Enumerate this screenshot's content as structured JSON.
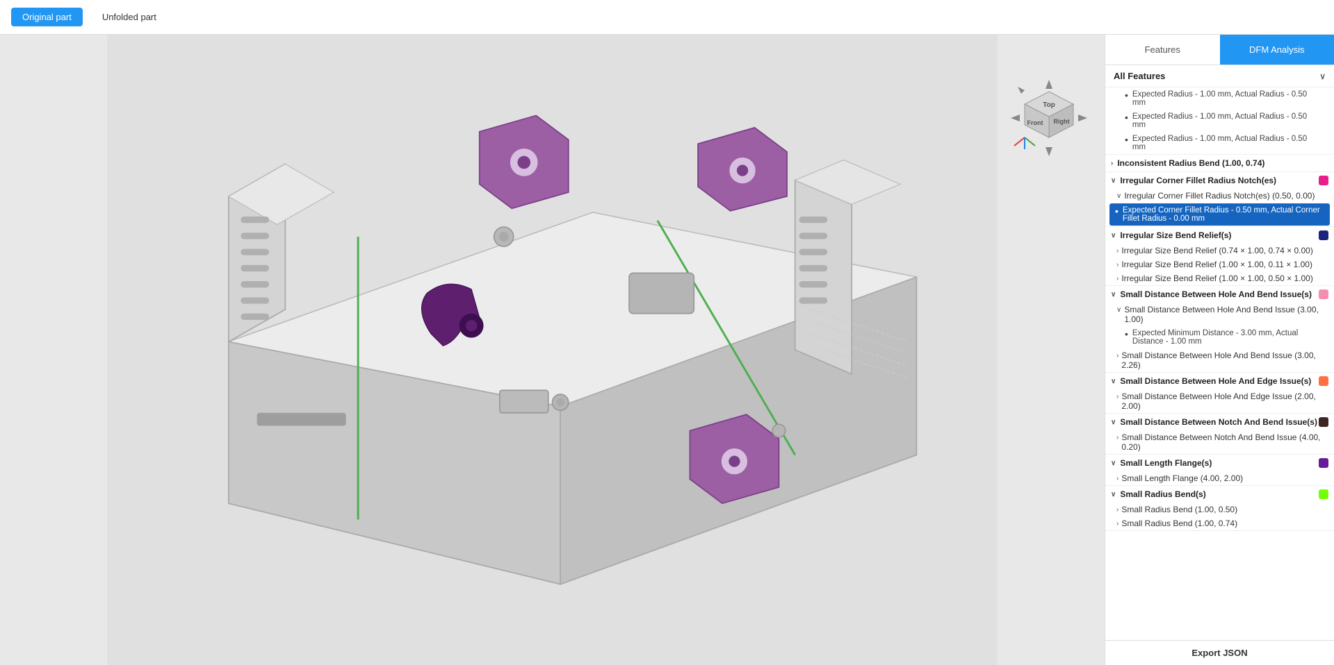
{
  "topBar": {
    "originalLabel": "Original part",
    "unfoldedLabel": "Unfolded part"
  },
  "tabs": [
    {
      "id": "features",
      "label": "Features",
      "active": false
    },
    {
      "id": "dfm",
      "label": "DFM Analysis",
      "active": true
    }
  ],
  "allFeatures": {
    "label": "All Features"
  },
  "featureGroups": [
    {
      "id": "inconsistent-radius-above",
      "items": [
        {
          "text": "Expected Radius - 1.00 mm, Actual Radius - 0.50 mm",
          "bullet": true
        },
        {
          "text": "Expected Radius - 1.00 mm, Actual Radius - 0.50 mm",
          "bullet": true
        },
        {
          "text": "Expected Radius - 1.00 mm, Actual Radius - 0.50 mm",
          "bullet": true
        }
      ],
      "collapsed": false,
      "showHeader": false
    },
    {
      "id": "inconsistent-radius-bend",
      "header": "Inconsistent Radius Bend (1.00, 0.74)",
      "chevron": "›",
      "collapsed": true,
      "showHeader": true
    },
    {
      "id": "irregular-corner-fillet",
      "header": "Irregular Corner Fillet Radius Notch(es)",
      "chevron": "∨",
      "collapsed": false,
      "showHeader": true,
      "color": "#e91e8c",
      "sub": [
        {
          "id": "irrg-corner-sub",
          "text": "Irregular Corner Fillet Radius Notch(es) (0.50, 0.00)",
          "chevron": "∨",
          "items": [
            {
              "text": "Expected Corner Fillet Radius - 0.50 mm, Actual Corner Fillet Radius - 0.00 mm",
              "bullet": true,
              "highlighted": true
            }
          ]
        }
      ]
    },
    {
      "id": "irregular-size-bend-relief",
      "header": "Irregular Size Bend Relief(s)",
      "chevron": "∨",
      "collapsed": false,
      "showHeader": true,
      "color": "#1a237e",
      "sub": [
        {
          "text": "Irregular Size Bend Relief (0.74 × 1.00, 0.74 × 0.00)",
          "chevron": "›"
        },
        {
          "text": "Irregular Size Bend Relief (1.00 × 1.00, 0.11 × 1.00)",
          "chevron": "›"
        },
        {
          "text": "Irregular Size Bend Relief (1.00 × 1.00, 0.50 × 1.00)",
          "chevron": "›"
        }
      ]
    },
    {
      "id": "small-dist-hole-bend",
      "header": "Small Distance Between Hole And Bend Issue(s)",
      "chevron": "∨",
      "collapsed": false,
      "showHeader": true,
      "color": "#f48fb1",
      "sub": [
        {
          "text": "Small Distance Between Hole And Bend Issue (3.00, 1.00)",
          "chevron": "∨",
          "items": [
            {
              "text": "Expected Minimum Distance - 3.00 mm, Actual Distance - 1.00 mm",
              "bullet": true
            }
          ]
        },
        {
          "text": "Small Distance Between Hole And Bend Issue (3.00, 2.26)",
          "chevron": "›"
        }
      ]
    },
    {
      "id": "small-dist-hole-edge",
      "header": "Small Distance Between Hole And Edge Issue(s)",
      "chevron": "∨",
      "collapsed": false,
      "showHeader": true,
      "color": "#ff7043",
      "sub": [
        {
          "text": "Small Distance Between Hole And Edge Issue (2.00, 2.00)",
          "chevron": "›"
        }
      ]
    },
    {
      "id": "small-dist-notch-bend",
      "header": "Small Distance Between Notch And Bend Issue(s)",
      "chevron": "∨",
      "collapsed": false,
      "showHeader": true,
      "color": "#3e2723",
      "sub": [
        {
          "text": "Small Distance Between Notch And Bend Issue (4.00, 0.20)",
          "chevron": "›"
        }
      ]
    },
    {
      "id": "small-length-flange",
      "header": "Small Length Flange(s)",
      "chevron": "∨",
      "collapsed": false,
      "showHeader": true,
      "color": "#6a1b9a",
      "sub": [
        {
          "text": "Small Length Flange (4.00, 2.00)",
          "chevron": "›"
        }
      ]
    },
    {
      "id": "small-radius-bend",
      "header": "Small Radius Bend(s)",
      "chevron": "∨",
      "collapsed": false,
      "showHeader": true,
      "color": "#76ff03",
      "sub": [
        {
          "text": "Small Radius Bend (1.00, 0.50)",
          "chevron": "›"
        },
        {
          "text": "Small Radius Bend (1.00, 0.74)",
          "chevron": "›"
        }
      ]
    }
  ],
  "exportLabel": "Export JSON"
}
